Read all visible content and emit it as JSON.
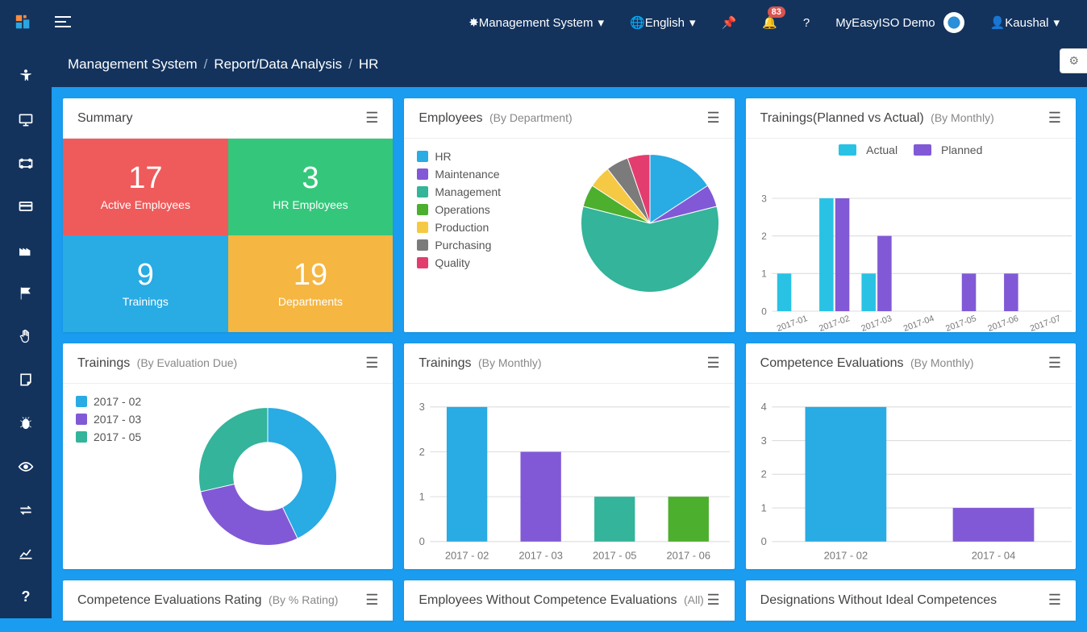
{
  "topbar": {
    "mgmt_label": "Management System",
    "lang_label": "English",
    "notif_count": "83",
    "brand_label": "MyEasyISO Demo",
    "user_label": "Kaushal"
  },
  "breadcrumb": {
    "a": "Management System",
    "b": "Report/Data Analysis",
    "c": "HR"
  },
  "summary": {
    "title": "Summary",
    "tiles": [
      {
        "value": "17",
        "label": "Active Employees"
      },
      {
        "value": "3",
        "label": "HR Employees"
      },
      {
        "value": "9",
        "label": "Trainings"
      },
      {
        "value": "19",
        "label": "Departments"
      }
    ]
  },
  "emp_dept": {
    "title": "Employees",
    "sub": "(By Department)"
  },
  "train_plan": {
    "title": "Trainings(Planned vs Actual)",
    "sub": "(By Monthly)"
  },
  "train_eval": {
    "title": "Trainings",
    "sub": "(By Evaluation Due)"
  },
  "train_month": {
    "title": "Trainings",
    "sub": "(By Monthly)"
  },
  "comp_eval": {
    "title": "Competence Evaluations",
    "sub": "(By Monthly)"
  },
  "comp_rating": {
    "title": "Competence Evaluations Rating",
    "sub": "(By % Rating)"
  },
  "emp_no_comp": {
    "title": "Employees Without Competence Evaluations",
    "sub": "(All)"
  },
  "desig_no_ideal": {
    "title": "Designations Without Ideal Competences"
  },
  "chart_data": [
    {
      "id": "employees_by_department",
      "type": "pie",
      "title": "Employees (By Department)",
      "series": [
        {
          "name": "HR",
          "value": 3,
          "color": "#29abe4"
        },
        {
          "name": "Maintenance",
          "value": 1,
          "color": "#8159d6"
        },
        {
          "name": "Management",
          "value": 11,
          "color": "#34b49a"
        },
        {
          "name": "Operations",
          "value": 1,
          "color": "#4caf2e"
        },
        {
          "name": "Production",
          "value": 1,
          "color": "#f6c945"
        },
        {
          "name": "Purchasing",
          "value": 1,
          "color": "#7b7b7b"
        },
        {
          "name": "Quality",
          "value": 1,
          "color": "#e33d6f"
        }
      ]
    },
    {
      "id": "trainings_planned_vs_actual",
      "type": "bar",
      "title": "Trainings(Planned vs Actual) (By Monthly)",
      "categories": [
        "2017-01",
        "2017-02",
        "2017-03",
        "2017-04",
        "2017-05",
        "2017-06",
        "2017-07"
      ],
      "series": [
        {
          "name": "Actual",
          "color": "#29c2e4",
          "values": [
            1,
            3,
            1,
            0,
            0,
            0,
            0
          ]
        },
        {
          "name": "Planned",
          "color": "#8159d6",
          "values": [
            0,
            3,
            2,
            0,
            1,
            1,
            0
          ]
        }
      ],
      "ylim": [
        0,
        3
      ]
    },
    {
      "id": "trainings_by_evaluation_due",
      "type": "pie",
      "donut": true,
      "title": "Trainings (By Evaluation Due)",
      "series": [
        {
          "name": "2017 - 02",
          "value": 3,
          "color": "#29abe4"
        },
        {
          "name": "2017 - 03",
          "value": 2,
          "color": "#8159d6"
        },
        {
          "name": "2017 - 05",
          "value": 2,
          "color": "#34b49a"
        }
      ]
    },
    {
      "id": "trainings_by_monthly",
      "type": "bar",
      "title": "Trainings (By Monthly)",
      "categories": [
        "2017 - 02",
        "2017 - 03",
        "2017 - 05",
        "2017 - 06"
      ],
      "series": [
        {
          "name": "2017 - 02",
          "color": "#29abe4",
          "value": 3
        },
        {
          "name": "2017 - 03",
          "color": "#8159d6",
          "value": 2
        },
        {
          "name": "2017 - 05",
          "color": "#34b49a",
          "value": 1
        },
        {
          "name": "2017 - 06",
          "color": "#4caf2e",
          "value": 1
        }
      ],
      "ylim": [
        0,
        3
      ]
    },
    {
      "id": "competence_evaluations_by_monthly",
      "type": "bar",
      "title": "Competence Evaluations (By Monthly)",
      "categories": [
        "2017 - 02",
        "2017 - 04"
      ],
      "series": [
        {
          "name": "2017 - 02",
          "color": "#29abe4",
          "value": 4
        },
        {
          "name": "2017 - 04",
          "color": "#8159d6",
          "value": 1
        }
      ],
      "ylim": [
        0,
        4
      ]
    }
  ]
}
